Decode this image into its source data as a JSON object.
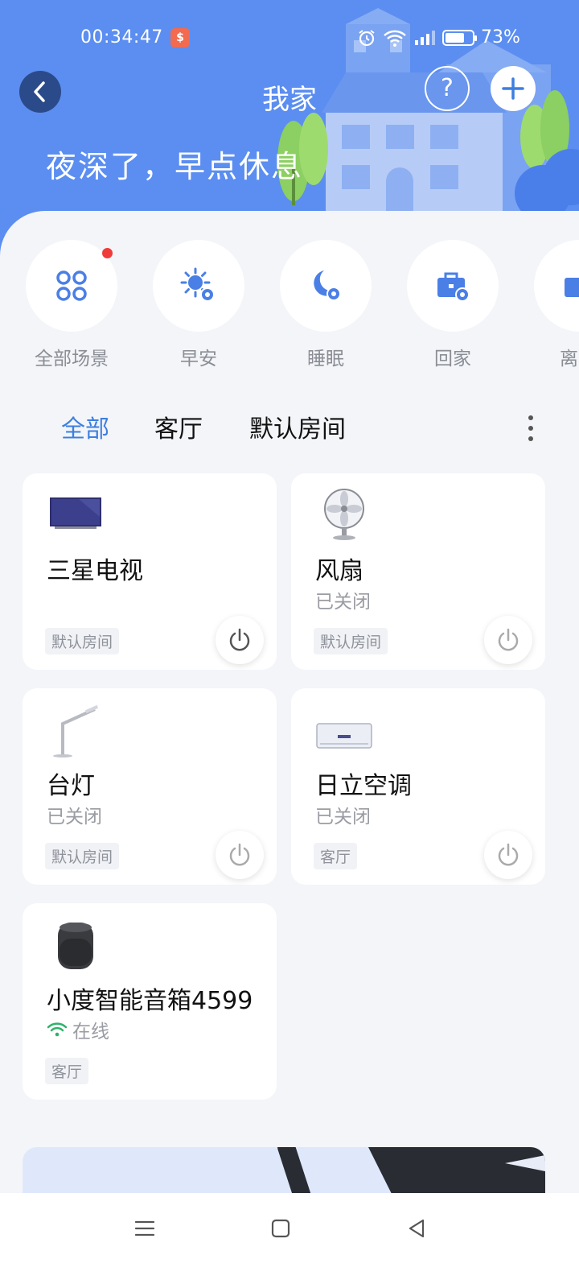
{
  "status_bar": {
    "time": "00:34:47",
    "battery": "73%",
    "battery_level": 0.73
  },
  "header": {
    "title": "我家",
    "greeting": "夜深了，早点休息"
  },
  "scenes": [
    {
      "label": "全部场景",
      "icon": "grid-icon",
      "badge": true
    },
    {
      "label": "早安",
      "icon": "sun-settings-icon"
    },
    {
      "label": "睡眠",
      "icon": "moon-settings-icon"
    },
    {
      "label": "回家",
      "icon": "briefcase-settings-icon"
    },
    {
      "label": "离",
      "icon": "leave-icon"
    }
  ],
  "tabs": [
    {
      "label": "全部",
      "active": true
    },
    {
      "label": "客厅"
    },
    {
      "label": "默认房间"
    }
  ],
  "devices": [
    {
      "name": "三星电视",
      "state": "",
      "room": "默认房间",
      "icon": "tv-icon"
    },
    {
      "name": "风扇",
      "state": "已关闭",
      "room": "默认房间",
      "icon": "fan-icon"
    },
    {
      "name": "台灯",
      "state": "已关闭",
      "room": "默认房间",
      "icon": "desk-lamp-icon"
    },
    {
      "name": "日立空调",
      "state": "已关闭",
      "room": "客厅",
      "icon": "air-conditioner-icon"
    },
    {
      "name": "小度智能音箱4599",
      "state": "在线",
      "room": "客厅",
      "icon": "smart-speaker-icon"
    }
  ],
  "colors": {
    "header": "#5b8ef0",
    "accent": "#3d7fe0",
    "badge": "#f03b3b",
    "online": "#2db36b"
  }
}
